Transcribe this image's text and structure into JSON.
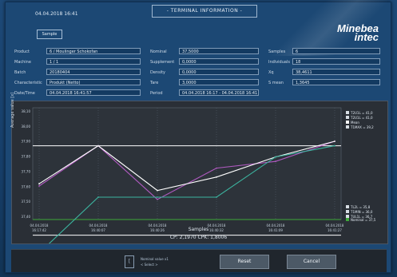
{
  "header": {
    "datetime": "04.04.2018 16:41",
    "title": "- TERMINAL INFORMATION -",
    "sample_button": "Sample",
    "logo_line1": "Minebea",
    "logo_line2": "intec"
  },
  "info": {
    "col1": [
      {
        "label": "Product",
        "value": "6 / Moulinger Schokofan"
      },
      {
        "label": "Machine",
        "value": "1 / 1"
      },
      {
        "label": "Batch",
        "value": "20180404"
      },
      {
        "label": "Characteristic",
        "value": "Produkt (Netto)"
      },
      {
        "label": "Date/Time",
        "value": "04.04.2018 16:41:57"
      }
    ],
    "col2": [
      {
        "label": "Nominal",
        "value": "37,5000"
      },
      {
        "label": "Supplement",
        "value": "0,0000"
      },
      {
        "label": "Density",
        "value": "0,0000"
      },
      {
        "label": "Tare",
        "value": "3,0000"
      },
      {
        "label": "Period",
        "value": "04.04.2018 16:17 - 04.04.2018 16:41"
      }
    ],
    "col3": [
      {
        "label": "Samples",
        "value": "6"
      },
      {
        "label": "Individuals",
        "value": "18"
      },
      {
        "label": "Xq",
        "value": "38,4611"
      },
      {
        "label": "S mean",
        "value": "1,3645"
      }
    ]
  },
  "chart_data": {
    "type": "line",
    "ylabel": "Average value [x]",
    "xlabel": "Samples",
    "cp_cpk": "CP: 2,1970  CPK: 1,8006",
    "ylim": [
      37.5,
      42.5
    ],
    "yticks": [
      "38,10",
      "38,00",
      "37,90",
      "37,80",
      "37,70",
      "37,60",
      "37,50",
      "37,40"
    ],
    "categories": [
      "04.04.2018\n16:17:42",
      "04.04.2018\n16:40:07",
      "04.04.2018\n16:40:26",
      "04.04.2018\n16:40:32",
      "04.04.2018\n16:41:09",
      "04.04.2018\n16:41:27"
    ],
    "x": [
      1,
      2,
      3,
      4,
      5,
      6
    ],
    "lines": [
      {
        "name": "T2MAX",
        "color": "#ffffff",
        "value": 40.8
      },
      {
        "name": "Nominal",
        "color": "#3ea83a",
        "value": 37.5
      },
      {
        "name": "TU1MIN",
        "color": "#ffffff",
        "value": 36.8
      }
    ],
    "series": [
      {
        "name": "Max",
        "color": "#b05ac0",
        "values": [
          39.0,
          40.8,
          38.4,
          39.8,
          40.1,
          41.0
        ]
      },
      {
        "name": "Mean",
        "color": "#ffffff",
        "values": [
          39.1,
          40.8,
          38.8,
          39.4,
          40.3,
          41.0
        ]
      },
      {
        "name": "Min",
        "color": "#3cb5a0",
        "values": [
          36.0,
          38.5,
          38.5,
          38.5,
          40.3,
          40.8
        ]
      }
    ],
    "legend_top": [
      {
        "text": "T2U1L = 41,0",
        "color": "#d8dee4"
      },
      {
        "text": "T2U1L = 41,0",
        "color": "#d8dee4"
      },
      {
        "text": "Mean",
        "color": "#ffffff"
      },
      {
        "text": "T1MAX = 39,2",
        "color": "#d8dee4"
      }
    ],
    "legend_nominal": {
      "text": "Nominal = 37,5",
      "color": "#3ea83a"
    },
    "legend_bottom": [
      {
        "text": "TL2L = 35,8",
        "color": "#d8dee4"
      },
      {
        "text": "T1MIN = 36,0",
        "color": "#d8dee4"
      },
      {
        "text": "TUL1L = 36,7",
        "color": "#d8dee4"
      }
    ]
  },
  "footer": {
    "nav_line1": "Nominal value x1",
    "nav_line2": "< Select >",
    "reset": "Reset",
    "cancel": "Cancel"
  }
}
